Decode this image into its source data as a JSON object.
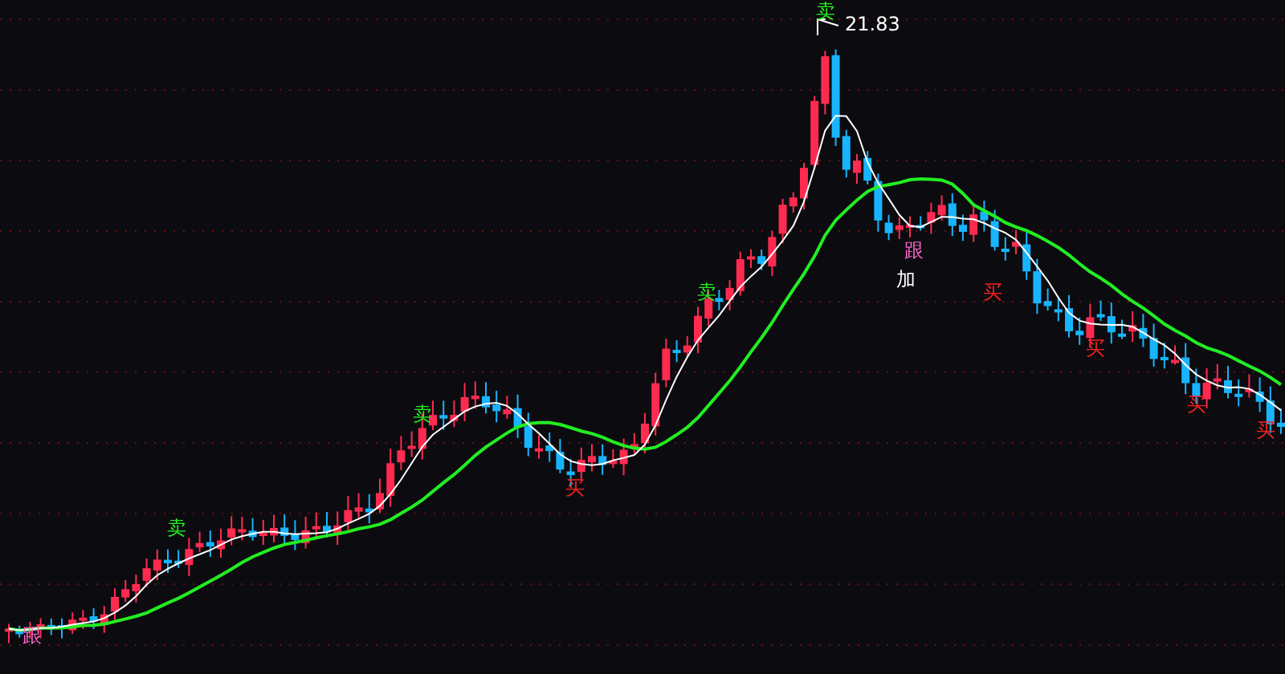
{
  "chart": {
    "price_label": "21.83",
    "signals": [
      {
        "kind": "follow",
        "label": "跟"
      },
      {
        "kind": "sell",
        "label": "卖"
      },
      {
        "kind": "sell",
        "label": "卖"
      },
      {
        "kind": "buy",
        "label": "买"
      },
      {
        "kind": "sell",
        "label": "卖"
      },
      {
        "kind": "sell",
        "label": "卖"
      },
      {
        "kind": "add",
        "label": "加"
      },
      {
        "kind": "follow",
        "label": "跟"
      },
      {
        "kind": "buy",
        "label": "买"
      },
      {
        "kind": "buy",
        "label": "买"
      },
      {
        "kind": "buy",
        "label": "买"
      },
      {
        "kind": "buy",
        "label": "买"
      }
    ]
  }
}
